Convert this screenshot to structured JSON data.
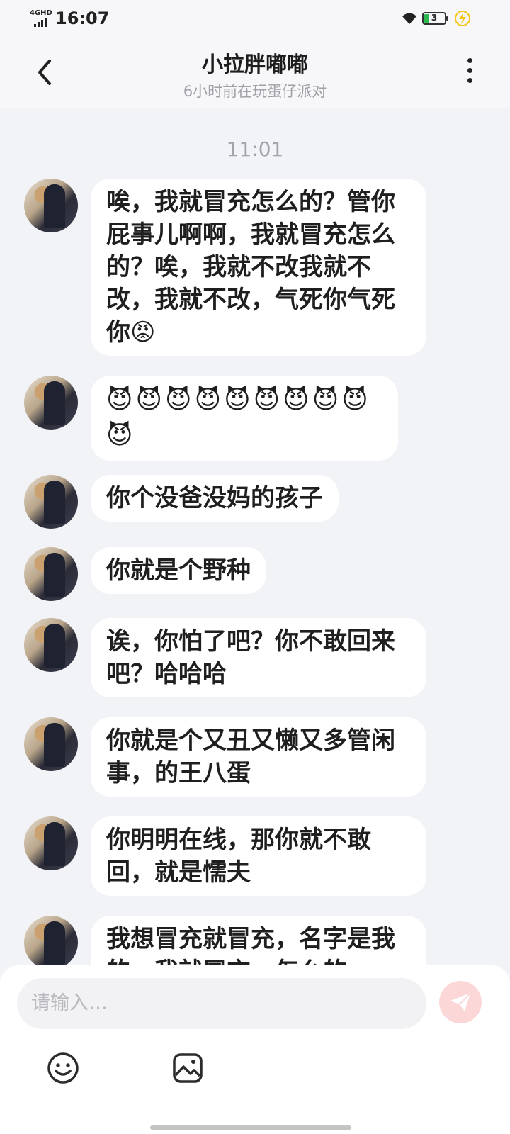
{
  "status": {
    "network": "4GHD",
    "time": "16:07",
    "battery": "3"
  },
  "header": {
    "title": "小拉胖嘟嘟",
    "subtitle": "6小时前在玩蛋仔派对"
  },
  "chat": {
    "timestamp": "11:01",
    "messages": [
      "唉，我就冒充怎么的？管你屁事儿啊啊，我就冒充怎么的？唉，我就不改我就不改，我就不改，气死你气死你😡",
      "😈😈😈😈😈😈😈😈😈😈",
      "你个没爸没妈的孩子",
      "你就是个野种",
      "诶，你怕了吧？你不敢回来吧？哈哈哈",
      "你就是个又丑又懒又多管闲事，的王八蛋",
      "你明明在线，那你就不敢回，就是懦夫",
      "我想冒充就冒充，名字是我的，我就冒充，怎么的"
    ]
  },
  "composer": {
    "placeholder": "请输入…"
  },
  "icons": {
    "back": "back-arrow-icon",
    "more": "more-vertical-icon",
    "wifi": "wifi-icon",
    "charging": "lightning-icon",
    "send": "send-icon",
    "emoji": "emoji-icon",
    "image": "image-icon"
  },
  "colors": {
    "send_button": "#fcd7d7",
    "chat_background": "#f2f3f7",
    "bubble": "#ffffff"
  }
}
